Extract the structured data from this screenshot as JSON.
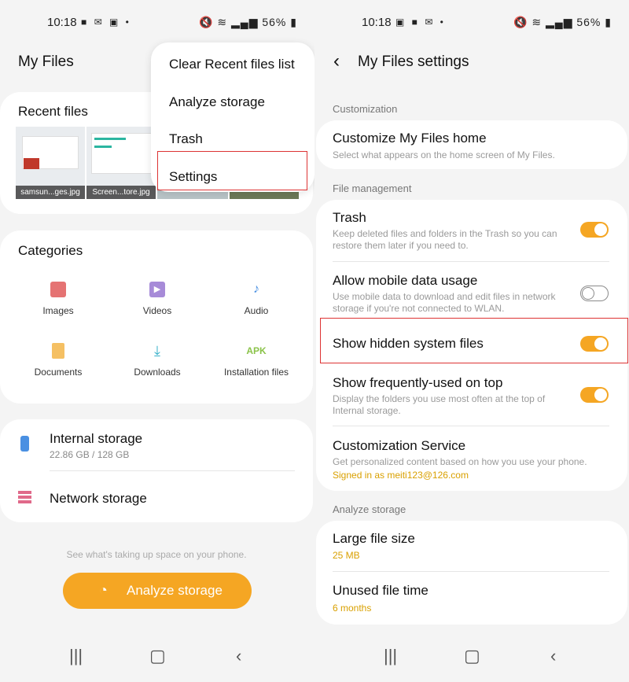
{
  "status": {
    "time": "10:18",
    "battery": "56%"
  },
  "left": {
    "app_title": "My Files",
    "menu": {
      "items": [
        "Clear Recent files list",
        "Analyze storage",
        "Trash",
        "Settings"
      ]
    },
    "recent": {
      "title": "Recent files",
      "thumbs": [
        "samsun...ges.jpg",
        "Screen...tore.jpg"
      ]
    },
    "categories": {
      "title": "Categories",
      "items": [
        "Images",
        "Videos",
        "Audio",
        "Documents",
        "Downloads",
        "Installation files"
      ],
      "apk_label": "APK"
    },
    "storage": {
      "internal_label": "Internal storage",
      "internal_usage": "22.86 GB / 128 GB",
      "network_label": "Network storage"
    },
    "analyze": {
      "hint": "See what's taking up space on your phone.",
      "button": "Analyze storage"
    }
  },
  "right": {
    "header": "My Files settings",
    "customization": {
      "section": "Customization",
      "home_title": "Customize My Files home",
      "home_sub": "Select what appears on the home screen of My Files."
    },
    "file_mgmt": {
      "section": "File management",
      "trash_title": "Trash",
      "trash_sub": "Keep deleted files and folders in the Trash so you can restore them later if you need to.",
      "mobile_title": "Allow mobile data usage",
      "mobile_sub": "Use mobile data to download and edit files in network storage if you're not connected to WLAN.",
      "hidden_title": "Show hidden system files",
      "freq_title": "Show frequently-used on top",
      "freq_sub": "Display the folders you use most often at the top of Internal storage.",
      "service_title": "Customization Service",
      "service_sub": "Get personalized content based on how you use your phone.",
      "signed_in": "Signed in as meiti123@126.com"
    },
    "analyze": {
      "section": "Analyze storage",
      "large_title": "Large file size",
      "large_value": "25 MB",
      "unused_title": "Unused file time",
      "unused_value": "6 months"
    }
  },
  "colors": {
    "accent": "#f5a623",
    "highlight": "#d33333"
  }
}
